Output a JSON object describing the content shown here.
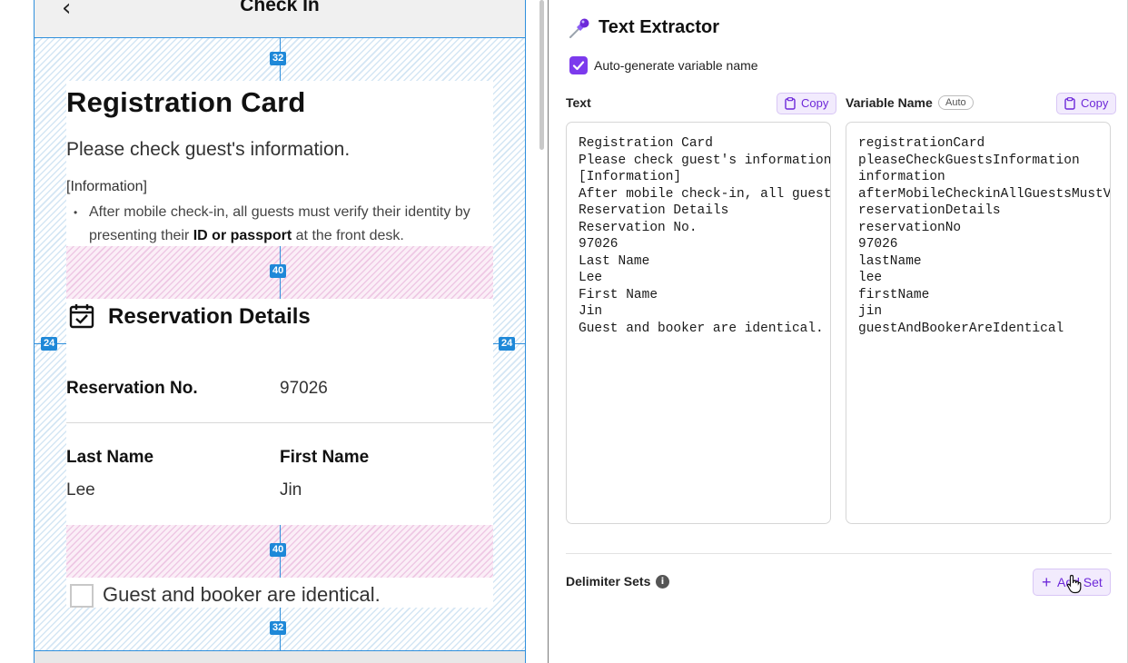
{
  "left": {
    "nav_title": "Check In",
    "back_glyph": "‹",
    "measures": {
      "top": "32",
      "gap1": "40",
      "left": "24",
      "right": "24",
      "gap2": "40",
      "bottom": "32"
    },
    "card": {
      "title": "Registration Card",
      "subtitle": "Please check guest's information.",
      "info_heading": "[Information]",
      "bullet_pre": "After mobile check-in, all guests must verify their identity by presenting their ",
      "bullet_bold": "ID or passport",
      "bullet_post": " at the front desk."
    },
    "reservation": {
      "title": "Reservation Details",
      "no_label": "Reservation No.",
      "no_value": "97026",
      "last_name_label": "Last Name",
      "last_name_value": "Lee",
      "first_name_label": "First Name",
      "first_name_value": "Jin"
    },
    "checkbox_label": "Guest and booker are identical."
  },
  "panel": {
    "title": "Text Extractor",
    "auto_generate_label": "Auto-generate variable name",
    "text_label": "Text",
    "variable_label": "Variable Name",
    "auto_badge": "Auto",
    "copy_label": "Copy",
    "text_lines": "Registration Card\nPlease check guest's information.\n[Information]\nAfter mobile check-in, all guests\nReservation Details\nReservation No.\n97026\nLast Name\nLee\nFirst Name\nJin\nGuest and booker are identical.",
    "variable_lines": "registrationCard\npleaseCheckGuestsInformation\ninformation\nafterMobileCheckinAllGuestsMustVe\nreservationDetails\nreservationNo\n97026\nlastName\nlee\nfirstName\njin\nguestAndBookerAreIdentical",
    "delimiter_label": "Delimiter Sets",
    "info_glyph": "i",
    "add_set_label": "Add Set",
    "add_glyph": "+"
  },
  "colors": {
    "accent": "#7c3aed",
    "measure_blue": "#1e88d8",
    "padding_hatch": "#d4e6f4",
    "gap_hatch": "#eec8e4"
  }
}
